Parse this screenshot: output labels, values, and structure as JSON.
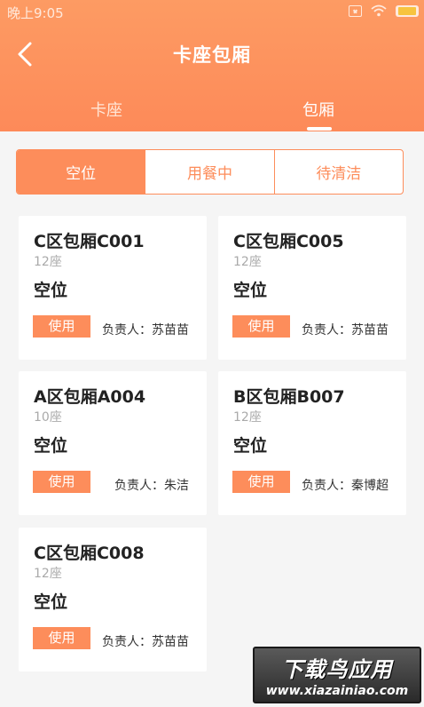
{
  "status_bar": {
    "time": "晚上9:05"
  },
  "nav": {
    "title": "卡座包厢"
  },
  "tabs": [
    {
      "label": "卡座",
      "active": false
    },
    {
      "label": "包厢",
      "active": true
    }
  ],
  "segments": [
    {
      "label": "空位",
      "active": true
    },
    {
      "label": "用餐中",
      "active": false
    },
    {
      "label": "待清洁",
      "active": false
    }
  ],
  "rooms": [
    {
      "name": "C区包厢C001",
      "seats": "12座",
      "status": "空位",
      "action": "使用",
      "manager": "负责人：苏苗苗"
    },
    {
      "name": "C区包厢C005",
      "seats": "12座",
      "status": "空位",
      "action": "使用",
      "manager": "负责人：苏苗苗"
    },
    {
      "name": "A区包厢A004",
      "seats": "10座",
      "status": "空位",
      "action": "使用",
      "manager": "负责人：朱洁"
    },
    {
      "name": "B区包厢B007",
      "seats": "12座",
      "status": "空位",
      "action": "使用",
      "manager": "负责人：秦博超"
    },
    {
      "name": "C区包厢C008",
      "seats": "12座",
      "status": "空位",
      "action": "使用",
      "manager": "负责人：苏苗苗"
    }
  ],
  "watermark": {
    "title": "下载鸟应用",
    "url": "www.xiazainiao.com"
  },
  "colors": {
    "accent": "#fd8d5b",
    "header": "#fd9b63",
    "background": "#f5f5f5"
  }
}
